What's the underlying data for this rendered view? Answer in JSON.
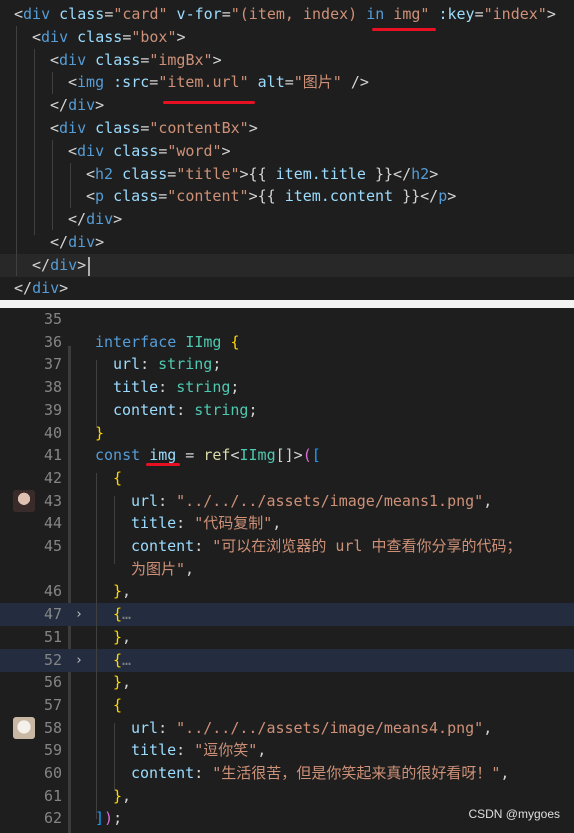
{
  "top_code": {
    "lines": [
      [
        [
          "t",
          "<"
        ],
        [
          "tag",
          "div"
        ],
        [
          "attr",
          " class"
        ],
        [
          "t",
          "="
        ],
        [
          "str",
          "\"card\""
        ],
        [
          "attr",
          " v-for"
        ],
        [
          "t",
          "="
        ],
        [
          "str",
          "\"(item, index) "
        ],
        [
          "kw",
          "in"
        ],
        [
          "str",
          " img\""
        ],
        [
          "attr",
          " :key"
        ],
        [
          "t",
          "="
        ],
        [
          "str",
          "\"index\""
        ],
        [
          "t",
          ">"
        ]
      ],
      [
        [
          "t",
          "<"
        ],
        [
          "tag",
          "div"
        ],
        [
          "attr",
          " class"
        ],
        [
          "t",
          "="
        ],
        [
          "str",
          "\"box\""
        ],
        [
          "t",
          ">"
        ]
      ],
      [
        [
          "t",
          "<"
        ],
        [
          "tag",
          "div"
        ],
        [
          "attr",
          " class"
        ],
        [
          "t",
          "="
        ],
        [
          "str",
          "\"imgBx\""
        ],
        [
          "t",
          ">"
        ]
      ],
      [
        [
          "t",
          "<"
        ],
        [
          "tag",
          "img"
        ],
        [
          "attr",
          " :src"
        ],
        [
          "t",
          "="
        ],
        [
          "str",
          "\"item.url\""
        ],
        [
          "attr",
          " alt"
        ],
        [
          "t",
          "="
        ],
        [
          "str",
          "\"图片\""
        ],
        [
          "t",
          " />"
        ]
      ],
      [
        [
          "t",
          "</"
        ],
        [
          "tag",
          "div"
        ],
        [
          "t",
          ">"
        ]
      ],
      [
        [
          "t",
          "<"
        ],
        [
          "tag",
          "div"
        ],
        [
          "attr",
          " class"
        ],
        [
          "t",
          "="
        ],
        [
          "str",
          "\"contentBx\""
        ],
        [
          "t",
          ">"
        ]
      ],
      [
        [
          "t",
          "<"
        ],
        [
          "tag",
          "div"
        ],
        [
          "attr",
          " class"
        ],
        [
          "t",
          "="
        ],
        [
          "str",
          "\"word\""
        ],
        [
          "t",
          ">"
        ]
      ],
      [
        [
          "t",
          "<"
        ],
        [
          "tag",
          "h2"
        ],
        [
          "attr",
          " class"
        ],
        [
          "t",
          "="
        ],
        [
          "str",
          "\"title\""
        ],
        [
          "t",
          ">{{ "
        ],
        [
          "var",
          "item.title"
        ],
        [
          "t",
          " }}</"
        ],
        [
          "tag",
          "h2"
        ],
        [
          "t",
          ">"
        ]
      ],
      [
        [
          "t",
          "<"
        ],
        [
          "tag",
          "p"
        ],
        [
          "attr",
          " class"
        ],
        [
          "t",
          "="
        ],
        [
          "str",
          "\"content\""
        ],
        [
          "t",
          ">{{ "
        ],
        [
          "var",
          "item.content"
        ],
        [
          "t",
          " }}</"
        ],
        [
          "tag",
          "p"
        ],
        [
          "t",
          ">"
        ]
      ],
      [
        [
          "t",
          "</"
        ],
        [
          "tag",
          "div"
        ],
        [
          "t",
          ">"
        ]
      ],
      [
        [
          "t",
          "</"
        ],
        [
          "tag",
          "div"
        ],
        [
          "t",
          ">"
        ]
      ],
      [
        [
          "t",
          "</"
        ],
        [
          "tag",
          "div"
        ],
        [
          "t",
          ">"
        ]
      ],
      [
        [
          "t",
          "</"
        ],
        [
          "tag",
          "div"
        ],
        [
          "t",
          ">"
        ]
      ]
    ]
  },
  "bottom_code": {
    "lines": [
      {
        "num": "35",
        "tokens": []
      },
      {
        "num": "36",
        "tokens": [
          [
            "kw",
            "interface"
          ],
          [
            "t",
            " "
          ],
          [
            "ty",
            "IImg"
          ],
          [
            "t",
            " "
          ],
          [
            "brace",
            "{"
          ]
        ]
      },
      {
        "num": "37",
        "tokens": [
          [
            "var",
            "url"
          ],
          [
            "t",
            ": "
          ],
          [
            "ty",
            "string"
          ],
          [
            "t",
            ";"
          ]
        ]
      },
      {
        "num": "38",
        "tokens": [
          [
            "var",
            "title"
          ],
          [
            "t",
            ": "
          ],
          [
            "ty",
            "string"
          ],
          [
            "t",
            ";"
          ]
        ]
      },
      {
        "num": "39",
        "tokens": [
          [
            "var",
            "content"
          ],
          [
            "t",
            ": "
          ],
          [
            "ty",
            "string"
          ],
          [
            "t",
            ";"
          ]
        ]
      },
      {
        "num": "40",
        "tokens": [
          [
            "brace",
            "}"
          ]
        ]
      },
      {
        "num": "41",
        "tokens": [
          [
            "kw",
            "const"
          ],
          [
            "t",
            " "
          ],
          [
            "var",
            "img"
          ],
          [
            "t",
            " = "
          ],
          [
            "fn",
            "ref"
          ],
          [
            "t",
            "<"
          ],
          [
            "ty",
            "IImg"
          ],
          [
            "t",
            "[]>"
          ],
          [
            "brace2",
            "("
          ],
          [
            "brace3",
            "["
          ]
        ]
      },
      {
        "num": "42",
        "tokens": [
          [
            "brace",
            "{"
          ]
        ]
      },
      {
        "num": "43",
        "tokens": [
          [
            "var",
            "url"
          ],
          [
            "t",
            ": "
          ],
          [
            "str",
            "\"../../../assets/image/means1.png\""
          ],
          [
            "t",
            ","
          ]
        ]
      },
      {
        "num": "44",
        "tokens": [
          [
            "var",
            "title"
          ],
          [
            "t",
            ": "
          ],
          [
            "str",
            "\"代码复制\""
          ],
          [
            "t",
            ","
          ]
        ]
      },
      {
        "num": "45",
        "tokens": [
          [
            "var",
            "content"
          ],
          [
            "t",
            ": "
          ],
          [
            "str",
            "\"可以在浏览器的 url 中查看你分享的代码；"
          ]
        ]
      },
      {
        "num": "",
        "tokens": [
          [
            "str",
            "为图片\""
          ],
          [
            "t",
            ","
          ]
        ]
      },
      {
        "num": "46",
        "tokens": [
          [
            "brace",
            "}"
          ],
          [
            "t",
            ","
          ]
        ]
      },
      {
        "num": "47",
        "tokens": [
          [
            "brace",
            "{"
          ],
          [
            "dim",
            "…"
          ]
        ]
      },
      {
        "num": "51",
        "tokens": [
          [
            "brace",
            "}"
          ],
          [
            "t",
            ","
          ]
        ]
      },
      {
        "num": "52",
        "tokens": [
          [
            "brace",
            "{"
          ],
          [
            "dim",
            "…"
          ]
        ]
      },
      {
        "num": "56",
        "tokens": [
          [
            "brace",
            "}"
          ],
          [
            "t",
            ","
          ]
        ]
      },
      {
        "num": "57",
        "tokens": [
          [
            "brace",
            "{"
          ]
        ]
      },
      {
        "num": "58",
        "tokens": [
          [
            "var",
            "url"
          ],
          [
            "t",
            ": "
          ],
          [
            "str",
            "\"../../../assets/image/means4.png\""
          ],
          [
            "t",
            ","
          ]
        ]
      },
      {
        "num": "59",
        "tokens": [
          [
            "var",
            "title"
          ],
          [
            "t",
            ": "
          ],
          [
            "str",
            "\"逗你笑\""
          ],
          [
            "t",
            ","
          ]
        ]
      },
      {
        "num": "60",
        "tokens": [
          [
            "var",
            "content"
          ],
          [
            "t",
            ": "
          ],
          [
            "str",
            "\"生活很苦，但是你笑起来真的很好看呀！\""
          ],
          [
            "t",
            ","
          ]
        ]
      },
      {
        "num": "61",
        "tokens": [
          [
            "brace",
            "}"
          ],
          [
            "t",
            ","
          ]
        ]
      },
      {
        "num": "62",
        "tokens": [
          [
            "brace3",
            "]"
          ],
          [
            "brace2",
            ")"
          ],
          [
            "t",
            ";"
          ]
        ]
      }
    ]
  },
  "fold_icon": "chevron-right-icon",
  "watermark": "CSDN @mygoes"
}
